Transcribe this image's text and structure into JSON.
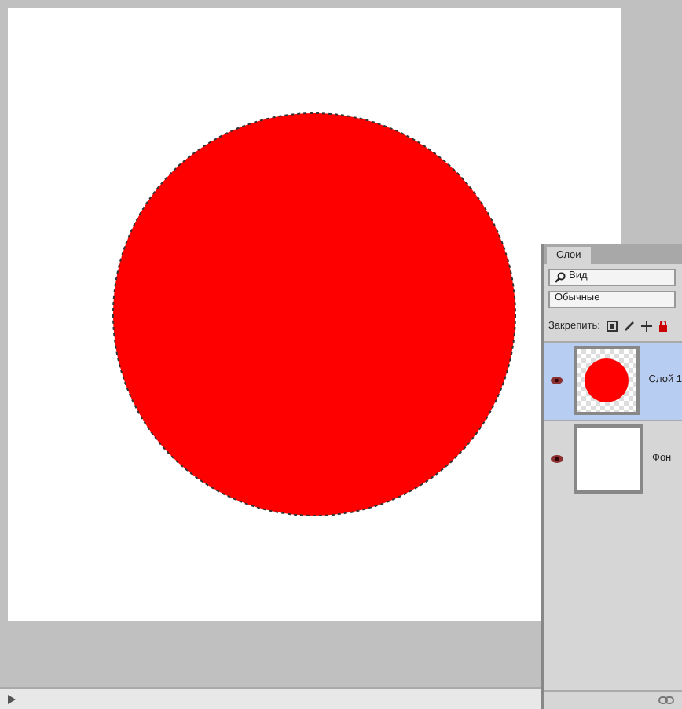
{
  "layers_panel": {
    "tab": "Слои",
    "filter": {
      "value": "Вид"
    },
    "blend_mode": {
      "value": "Обычные"
    },
    "lock_label": "Закрепить:",
    "layers": [
      {
        "name": "Слой 1",
        "selected": true,
        "visible": true,
        "kind": "circle"
      },
      {
        "name": "Фон",
        "selected": false,
        "visible": true,
        "kind": "fill"
      }
    ]
  }
}
